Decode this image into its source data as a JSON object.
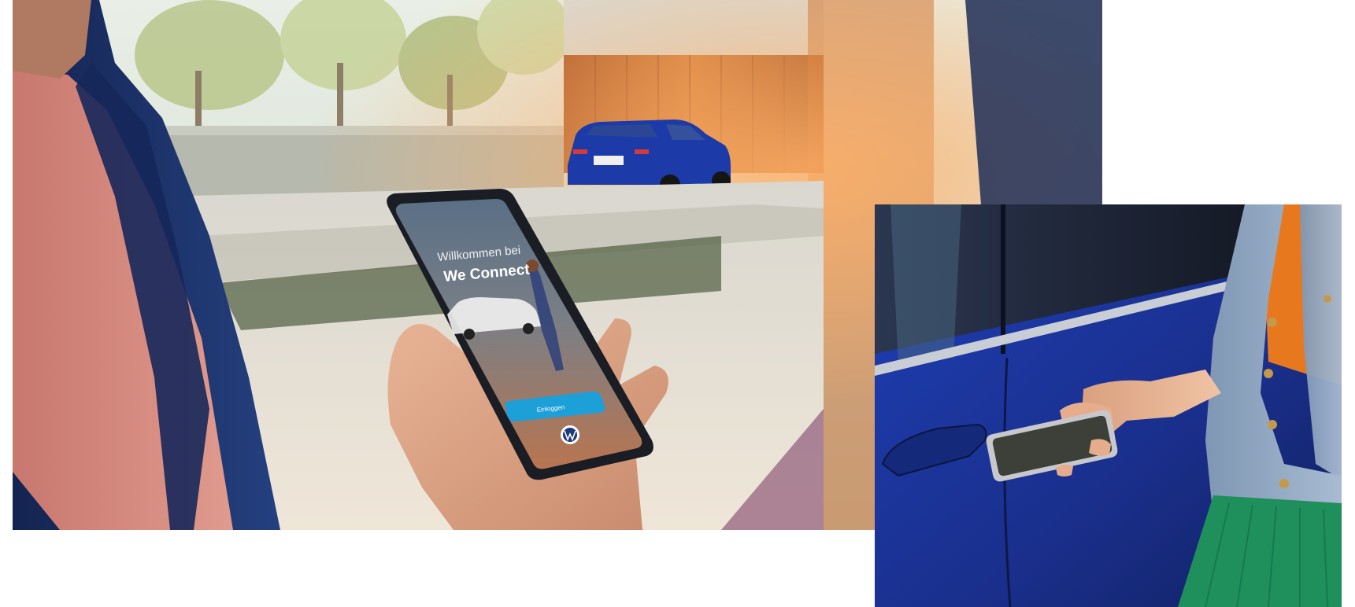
{
  "left_photo": {
    "app_screen": {
      "welcome_line": "Willkommen bei",
      "app_name": "We Connect",
      "button_label": "Einloggen",
      "logo_icon": "vw-logo-icon"
    }
  },
  "right_photo": {
    "phone_screen_icon": "blank-screen-icon"
  },
  "colors": {
    "car_blue": "#1c3aa8",
    "jacket_navy": "#1a2d66",
    "shirt_pink": "#d98c80",
    "button_cyan": "#1d9fd8",
    "skirt_green": "#1f8f5c",
    "blouse_orange": "#e8781e",
    "denim": "#8ea6c2",
    "wood_orange": "#c46a2a"
  }
}
